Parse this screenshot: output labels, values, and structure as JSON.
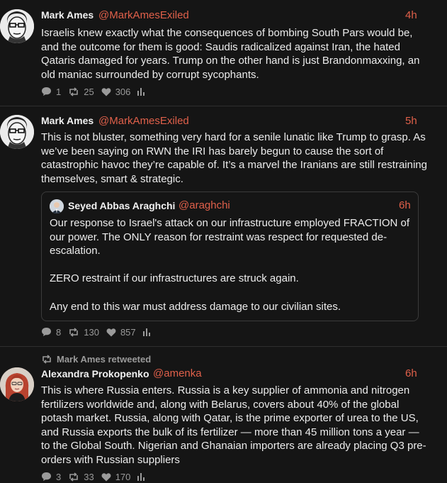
{
  "colors": {
    "background": "#151515",
    "accent": "#e0604a",
    "muted": "#9a9a9a"
  },
  "posts": [
    {
      "author": "Mark Ames",
      "handle": "@MarkAmesExiled",
      "time": "4h",
      "text": "Israelis knew exactly what the consequences of bombing South Pars would be, and the outcome for them is good: Saudis radicalized against Iran, the hated Qataris damaged for years. Trump on the other hand is just Brandonmaxxing, an old maniac surrounded by corrupt sycophants.",
      "replies": "1",
      "reposts": "25",
      "likes": "306"
    },
    {
      "author": "Mark Ames",
      "handle": "@MarkAmesExiled",
      "time": "5h",
      "text": "This is not bluster, something very hard for a senile lunatic like Trump to grasp. As we’ve been saying on RWN the IRI has barely begun to cause the sort of catastrophic havoc they’re capable of. It’s a marvel the Iranians are still restraining themselves, smart & strategic.",
      "quote": {
        "author": "Seyed Abbas Araghchi",
        "handle": "@araghchi",
        "time": "6h",
        "text": "Our response to Israel's attack on our infrastructure employed FRACTION of our power. The ONLY reason for restraint was respect for requested de-escalation.\n\nZERO restraint if our infrastructures are struck again.\n\nAny end to this war must address damage to our civilian sites."
      },
      "replies": "8",
      "reposts": "130",
      "likes": "857"
    },
    {
      "retweeted_by": "Mark Ames retweeted",
      "author": "Alexandra Prokopenko",
      "handle": "@amenka",
      "time": "6h",
      "text": "This is where Russia enters. Russia is a key supplier of ammonia and nitrogen fertilizers worldwide and, along with Belarus, covers about 40% of the global potash market. Russia, along with Qatar, is the prime exporter of urea to the US, and Russia exports the bulk of its fertilizer — more than 45 million tons a year — to the Global South. Nigerian and Ghanaian importers are already placing Q3 pre-orders with Russian suppliers",
      "replies": "3",
      "reposts": "33",
      "likes": "170"
    }
  ]
}
